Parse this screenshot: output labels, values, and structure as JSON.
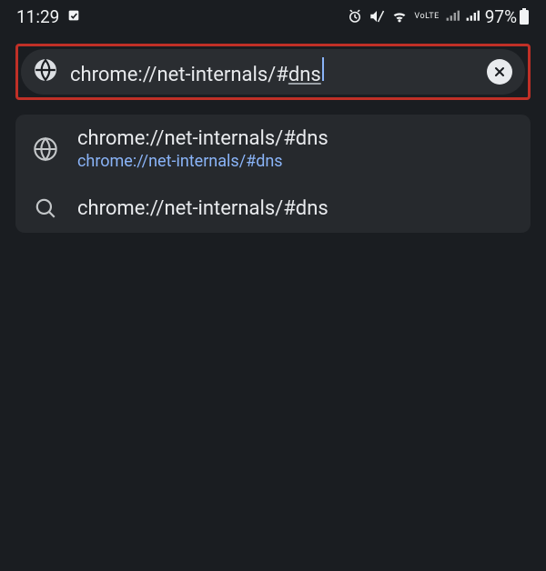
{
  "status_bar": {
    "time": "11:29",
    "battery_percent": "97%"
  },
  "url_bar": {
    "text_prefix": "chrome://net-internals/#",
    "text_underlined": "dns"
  },
  "suggestions": [
    {
      "icon": "globe",
      "title": "chrome://net-internals/#dns",
      "subtitle": "chrome://net-internals/#dns"
    },
    {
      "icon": "search",
      "title": "chrome://net-internals/#dns",
      "subtitle": ""
    }
  ]
}
